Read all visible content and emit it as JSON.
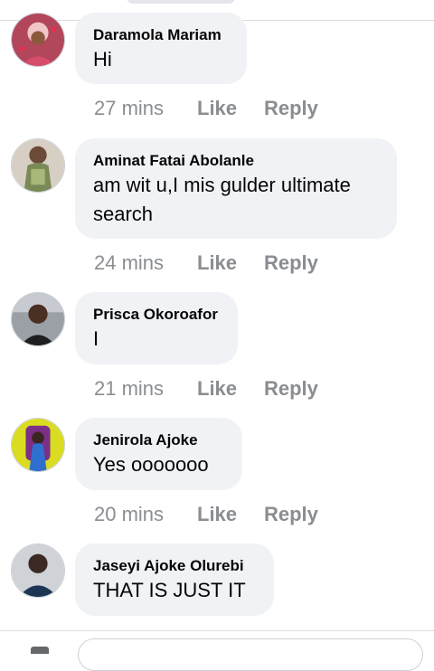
{
  "comments": [
    {
      "author": "Daramola Mariam",
      "text": "Hi",
      "time": "27 mins",
      "like": "Like",
      "reply": "Reply"
    },
    {
      "author": "Aminat Fatai Abolanle",
      "text": "am wit u,I mis gulder ultimate search",
      "time": "24 mins",
      "like": "Like",
      "reply": "Reply"
    },
    {
      "author": "Prisca Okoroafor",
      "text": "I",
      "time": "21 mins",
      "like": "Like",
      "reply": "Reply"
    },
    {
      "author": "Jenirola Ajoke",
      "text": "Yes ooooooo",
      "time": "20 mins",
      "like": "Like",
      "reply": "Reply"
    },
    {
      "author": "Jaseyi Ajoke Olurebi",
      "text": "THAT IS JUST IT",
      "time": "",
      "like": "",
      "reply": ""
    }
  ],
  "colors": {
    "bubble": "#f0f2f5",
    "meta": "#8a8d91",
    "text": "#050505"
  },
  "icons": {
    "avatar": "profile-photo",
    "camera": "camera-icon"
  }
}
